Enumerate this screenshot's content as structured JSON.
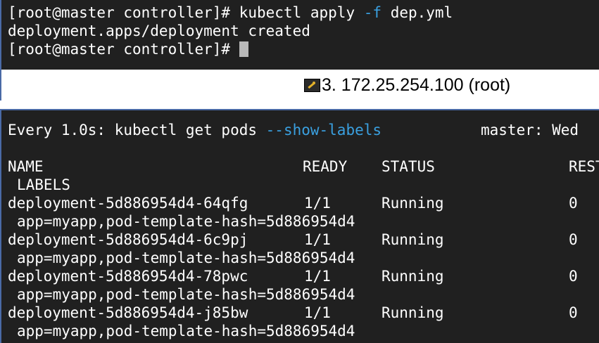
{
  "top_terminal": {
    "line1_prompt": "[root@master controller]# ",
    "line1_cmd": "kubectl apply ",
    "line1_flag": "-f",
    "line1_arg": " dep.yml",
    "line2": "deployment.apps/deployment created",
    "line3_prompt": "[root@master controller]# "
  },
  "title_bar": {
    "title": "3. 172.25.254.100 (root)"
  },
  "bottom_terminal": {
    "watch_prefix": "Every 1.0s: kubectl get pods ",
    "watch_flag": "--show-labels",
    "watch_host": "master: Wed ",
    "columns": {
      "name": "NAME",
      "ready": "READY",
      "status": "STATUS",
      "restarts": "RESTARTS",
      "labels": "LABELS"
    },
    "pods": [
      {
        "name": "deployment-5d886954d4-64qfg",
        "ready": "1/1",
        "status": "Running",
        "restarts": "0",
        "labels": "app=myapp,pod-template-hash=5d886954d4"
      },
      {
        "name": "deployment-5d886954d4-6c9pj",
        "ready": "1/1",
        "status": "Running",
        "restarts": "0",
        "labels": "app=myapp,pod-template-hash=5d886954d4"
      },
      {
        "name": "deployment-5d886954d4-78pwc",
        "ready": "1/1",
        "status": "Running",
        "restarts": "0",
        "labels": "app=myapp,pod-template-hash=5d886954d4"
      },
      {
        "name": "deployment-5d886954d4-j85bw",
        "ready": "1/1",
        "status": "Running",
        "restarts": "0",
        "labels": "app=myapp,pod-template-hash=5d886954d4"
      }
    ]
  },
  "colors": {
    "terminal_bg": "#202020",
    "text": "#ffffff",
    "flag": "#3aa0e0",
    "pane_border": "#4a6aa6"
  }
}
